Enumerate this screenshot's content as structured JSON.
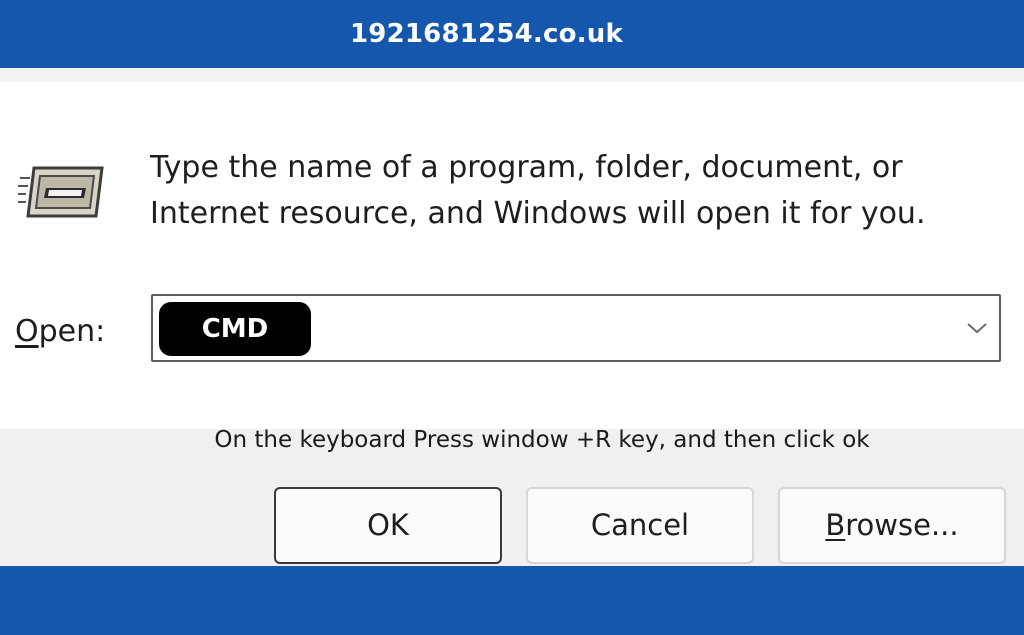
{
  "banner": {
    "title": "1921681254.co.uk"
  },
  "dialog": {
    "icon": "run-program-icon",
    "instruction_line1": "Type the name of a program, folder, document, or",
    "instruction_line2": "Internet resource, and Windows will open it for you.",
    "open_label_mnemonic": "O",
    "open_label_rest": "pen:",
    "open_value": "CMD",
    "dropdown_icon": "chevron-down-icon"
  },
  "hint": "On the keyboard Press window +R key, and then click ok",
  "buttons": {
    "ok": "OK",
    "cancel": "Cancel",
    "browse_mnemonic": "B",
    "browse_rest": "rowse..."
  },
  "colors": {
    "banner": "#1457ad",
    "footer": "#f0f0f0",
    "value_highlight": "#000000"
  }
}
